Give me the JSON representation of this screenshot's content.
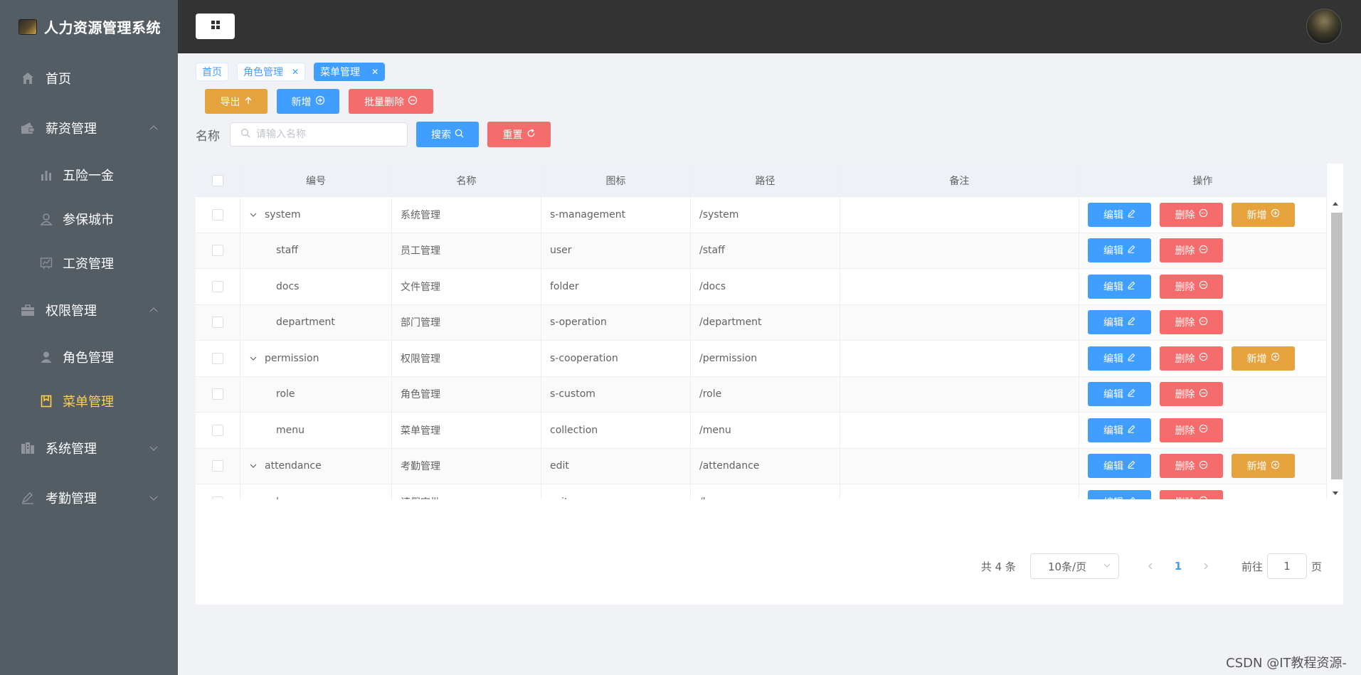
{
  "app": {
    "title": "人力资源管理系统"
  },
  "sidebar": {
    "items": [
      {
        "label": "首页",
        "icon": "home-icon"
      },
      {
        "label": "薪资管理",
        "icon": "wallet-icon",
        "expanded": true,
        "children": [
          {
            "label": "五险一金",
            "icon": "bar-chart-icon"
          },
          {
            "label": "参保城市",
            "icon": "user-icon"
          },
          {
            "label": "工资管理",
            "icon": "line-chart-icon"
          }
        ]
      },
      {
        "label": "权限管理",
        "icon": "briefcase-icon",
        "expanded": true,
        "children": [
          {
            "label": "角色管理",
            "icon": "user-solid-icon"
          },
          {
            "label": "菜单管理",
            "icon": "notebook-icon",
            "active": true
          }
        ]
      },
      {
        "label": "系统管理",
        "icon": "office-icon",
        "expanded": false
      },
      {
        "label": "考勤管理",
        "icon": "pen-icon",
        "expanded": false
      }
    ],
    "active_color": "#ffd04b",
    "background": "#545c64"
  },
  "tags": [
    {
      "label": "首页",
      "closable": false
    },
    {
      "label": "角色管理",
      "closable": true
    },
    {
      "label": "菜单管理",
      "closable": true,
      "active": true
    }
  ],
  "toolbar": {
    "export_label": "导出",
    "add_label": "新增",
    "batch_delete_label": "批量删除"
  },
  "search": {
    "label": "名称",
    "placeholder": "请输入名称",
    "value": "",
    "search_label": "搜索",
    "reset_label": "重置"
  },
  "table": {
    "headers": {
      "id": "编号",
      "name": "名称",
      "icon": "图标",
      "path": "路径",
      "note": "备注",
      "ops": "操作"
    },
    "rows": [
      {
        "id": "system",
        "name": "系统管理",
        "icon": "s-management",
        "path": "/system",
        "note": "",
        "parent": true
      },
      {
        "id": "staff",
        "name": "员工管理",
        "icon": "user",
        "path": "/staff",
        "note": "",
        "parent": false
      },
      {
        "id": "docs",
        "name": "文件管理",
        "icon": "folder",
        "path": "/docs",
        "note": "",
        "parent": false
      },
      {
        "id": "department",
        "name": "部门管理",
        "icon": "s-operation",
        "path": "/department",
        "note": "",
        "parent": false
      },
      {
        "id": "permission",
        "name": "权限管理",
        "icon": "s-cooperation",
        "path": "/permission",
        "note": "",
        "parent": true
      },
      {
        "id": "role",
        "name": "角色管理",
        "icon": "s-custom",
        "path": "/role",
        "note": "",
        "parent": false
      },
      {
        "id": "menu",
        "name": "菜单管理",
        "icon": "collection",
        "path": "/menu",
        "note": "",
        "parent": false
      },
      {
        "id": "attendance",
        "name": "考勤管理",
        "icon": "edit",
        "path": "/attendance",
        "note": "",
        "parent": true
      },
      {
        "id": "leave",
        "name": "请假审批",
        "icon": "suitcase",
        "path": "/leave",
        "note": "",
        "parent": false
      },
      {
        "id": "",
        "name": "",
        "icon": "",
        "path": "",
        "note": "",
        "parent": false,
        "partial": true
      }
    ],
    "edit_label": "编辑",
    "delete_label": "删除",
    "add_label": "新增"
  },
  "pagination": {
    "total_text": "共 4 条",
    "page_size": "10条/页",
    "current_page": "1",
    "goto_prefix": "前往",
    "goto_value": "1",
    "goto_suffix": "页"
  },
  "watermark": "CSDN @IT教程资源-",
  "colors": {
    "primary": "#409eff",
    "danger": "#f56c6c",
    "warning": "#e6a23c",
    "header": "#333333"
  }
}
